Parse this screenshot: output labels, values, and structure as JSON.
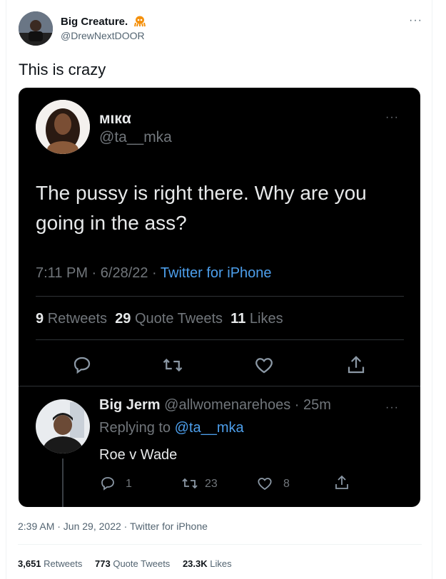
{
  "author": {
    "name": "Big Creature.",
    "handle": "@DrewNextDOOR",
    "badge_icon": "octopus-emoji-icon"
  },
  "tweet": {
    "text": "This is crazy"
  },
  "embedded": {
    "quoted": {
      "name": "мιкα",
      "handle": "@ta__mka",
      "text": "The pussy is right there. Why are you going in the ass?",
      "time": "7:11 PM · 6/28/22 · ",
      "source": "Twitter for iPhone",
      "retweets_count": "9",
      "retweets_label": "Retweets",
      "quotes_count": "29",
      "quotes_label": "Quote Tweets",
      "likes_count": "11",
      "likes_label": "Likes"
    },
    "reply": {
      "name": "Big Jerm",
      "handle": "@allwomenarehoes",
      "age": "· 25m",
      "replying_prefix": "Replying to",
      "replying_to": "@ta__mka",
      "text": "Roe v Wade",
      "reply_count": "1",
      "retweet_count": "23",
      "like_count": "8"
    }
  },
  "meta": {
    "timestamp": "2:39 AM · Jun 29, 2022 · Twitter for iPhone"
  },
  "stats": {
    "retweets_count": "3,651",
    "retweets_label": "Retweets",
    "quotes_count": "773",
    "quotes_label": "Quote Tweets",
    "likes_count": "23.3K",
    "likes_label": "Likes"
  },
  "colors": {
    "link": "#1d9bf0",
    "muted": "#536471",
    "dark_bg": "#000000"
  }
}
